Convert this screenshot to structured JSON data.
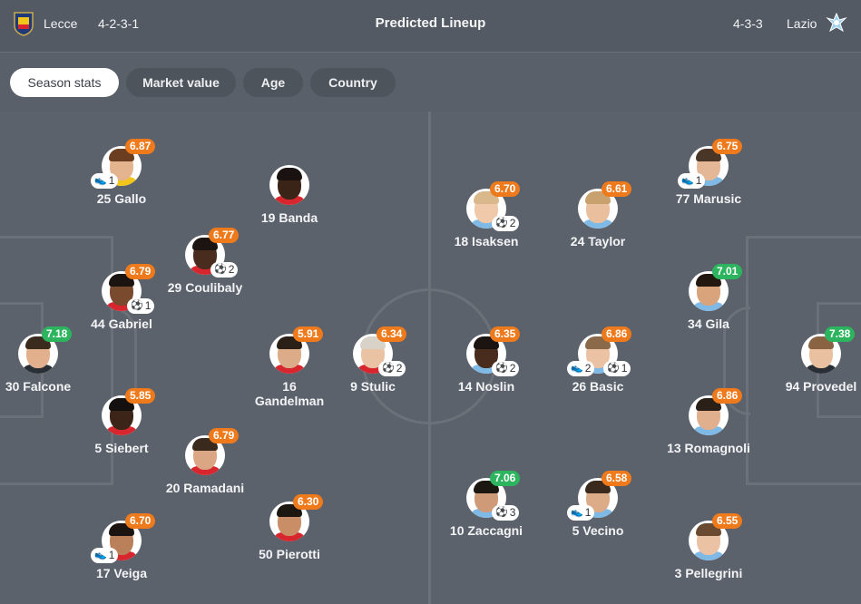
{
  "header": {
    "home_team": "Lecce",
    "home_formation": "4-2-3-1",
    "title": "Predicted Lineup",
    "away_formation": "4-3-3",
    "away_team": "Lazio"
  },
  "tabs": [
    "Season stats",
    "Market value",
    "Age",
    "Country"
  ],
  "players": [
    {
      "name": "25 Gallo",
      "rating": "6.87",
      "rating_color": "orange",
      "badge_icon": "boot-icon",
      "badge_count": "1",
      "badge_side": "left",
      "skin": "#e4b48e",
      "hair": "#6b3e22",
      "shirt": "#f2c51a"
    },
    {
      "name": "19 Banda",
      "rating": "",
      "rating_color": "orange",
      "badge_icon": "",
      "badge_count": "",
      "badge_side": "",
      "skin": "#3a2418",
      "hair": "#1a1210",
      "shirt": "#d7262e"
    },
    {
      "name": "29 Coulibaly",
      "rating": "6.77",
      "rating_color": "orange",
      "badge_icon": "ball-icon",
      "badge_count": "2",
      "badge_side": "right",
      "skin": "#4a2c1e",
      "hair": "#1b1410",
      "shirt": "#d7262e"
    },
    {
      "name": "44 Gabriel",
      "rating": "6.79",
      "rating_color": "orange",
      "badge_icon": "ball-icon",
      "badge_count": "1",
      "badge_side": "right",
      "skin": "#7a4a2e",
      "hair": "#1b1410",
      "shirt": "#d7262e"
    },
    {
      "name": "30 Falcone",
      "rating": "7.18",
      "rating_color": "green",
      "badge_icon": "",
      "badge_count": "",
      "badge_side": "",
      "skin": "#e2b08c",
      "hair": "#3b2a1e",
      "shirt": "#2a2f36"
    },
    {
      "name": "16 Gandelman",
      "rating": "5.91",
      "rating_color": "orange",
      "badge_icon": "",
      "badge_count": "",
      "badge_side": "",
      "skin": "#dcab88",
      "hair": "#2a2018",
      "shirt": "#d7262e"
    },
    {
      "name": "9 Stulic",
      "rating": "6.34",
      "rating_color": "orange",
      "badge_icon": "ball-icon",
      "badge_count": "2",
      "badge_side": "right",
      "skin": "#eac3a4",
      "hair": "#d9d2c8",
      "shirt": "#d7262e"
    },
    {
      "name": "5 Siebert",
      "rating": "5.85",
      "rating_color": "orange",
      "badge_icon": "",
      "badge_count": "",
      "badge_side": "",
      "skin": "#3c2419",
      "hair": "#151010",
      "shirt": "#d7262e"
    },
    {
      "name": "20 Ramadani",
      "rating": "6.79",
      "rating_color": "orange",
      "badge_icon": "",
      "badge_count": "",
      "badge_side": "",
      "skin": "#dba684",
      "hair": "#3a2a1e",
      "shirt": "#d7262e"
    },
    {
      "name": "50 Pierotti",
      "rating": "6.30",
      "rating_color": "orange",
      "badge_icon": "",
      "badge_count": "",
      "badge_side": "",
      "skin": "#c98e66",
      "hair": "#1d1712",
      "shirt": "#d7262e"
    },
    {
      "name": "17 Veiga",
      "rating": "6.70",
      "rating_color": "orange",
      "badge_icon": "boot-icon",
      "badge_count": "1",
      "badge_side": "left",
      "skin": "#b9805a",
      "hair": "#1b1410",
      "shirt": "#d7262e"
    },
    {
      "name": "18 Isaksen",
      "rating": "6.70",
      "rating_color": "orange",
      "badge_icon": "ball-icon",
      "badge_count": "2",
      "badge_side": "right",
      "skin": "#f0c8aa",
      "hair": "#d9b98c",
      "shirt": "#7fb9e6"
    },
    {
      "name": "24 Taylor",
      "rating": "6.61",
      "rating_color": "orange",
      "badge_icon": "",
      "badge_count": "",
      "badge_side": "",
      "skin": "#e9bf9e",
      "hair": "#c9a16e",
      "shirt": "#7fb9e6"
    },
    {
      "name": "77 Marusic",
      "rating": "6.75",
      "rating_color": "orange",
      "badge_icon": "boot-icon",
      "badge_count": "1",
      "badge_side": "left",
      "skin": "#e4b896",
      "hair": "#4a3626",
      "shirt": "#7fb9e6"
    },
    {
      "name": "34 Gila",
      "rating": "7.01",
      "rating_color": "green",
      "badge_icon": "",
      "badge_count": "",
      "badge_side": "",
      "skin": "#d9a47c",
      "hair": "#22180f",
      "shirt": "#7fb9e6"
    },
    {
      "name": "14 Noslin",
      "rating": "6.35",
      "rating_color": "orange",
      "badge_icon": "ball-icon",
      "badge_count": "2",
      "badge_side": "right",
      "skin": "#4a2c1e",
      "hair": "#1b1410",
      "shirt": "#7fb9e6"
    },
    {
      "name": "26 Basic",
      "rating": "6.86",
      "rating_color": "orange",
      "badge_icon": "boot-icon",
      "badge_count": "2",
      "badge_side": "left",
      "badge2_icon": "ball-icon",
      "badge2_count": "1",
      "skin": "#ebc3a4",
      "hair": "#8a6a48",
      "shirt": "#7fb9e6"
    },
    {
      "name": "94 Provedel",
      "rating": "7.38",
      "rating_color": "green",
      "badge_icon": "",
      "badge_count": "",
      "badge_side": "",
      "skin": "#e9c1a0",
      "hair": "#8a6442",
      "shirt": "#2a2f36"
    },
    {
      "name": "13 Romagnoli",
      "rating": "6.86",
      "rating_color": "orange",
      "badge_icon": "",
      "badge_count": "",
      "badge_side": "",
      "skin": "#e0b08e",
      "hair": "#2a2018",
      "shirt": "#7fb9e6"
    },
    {
      "name": "10 Zaccagni",
      "rating": "7.06",
      "rating_color": "green",
      "badge_icon": "ball-icon",
      "badge_count": "3",
      "badge_side": "right",
      "skin": "#cf9a78",
      "hair": "#1d1712",
      "shirt": "#7fb9e6"
    },
    {
      "name": "5 Vecino",
      "rating": "6.58",
      "rating_color": "orange",
      "badge_icon": "boot-icon",
      "badge_count": "1",
      "badge_side": "left",
      "skin": "#dcab88",
      "hair": "#3a2a1e",
      "shirt": "#7fb9e6"
    },
    {
      "name": "3 Pellegrini",
      "rating": "6.55",
      "rating_color": "orange",
      "badge_icon": "",
      "badge_count": "",
      "badge_side": "",
      "skin": "#ebc3a4",
      "hair": "#6a4a30",
      "shirt": "#7fb9e6"
    }
  ],
  "colors": {
    "rating_orange": "#ef7a1c",
    "rating_green": "#2cb55e",
    "pitch": "#5c626b",
    "pitch_lines": "#6b7079"
  }
}
